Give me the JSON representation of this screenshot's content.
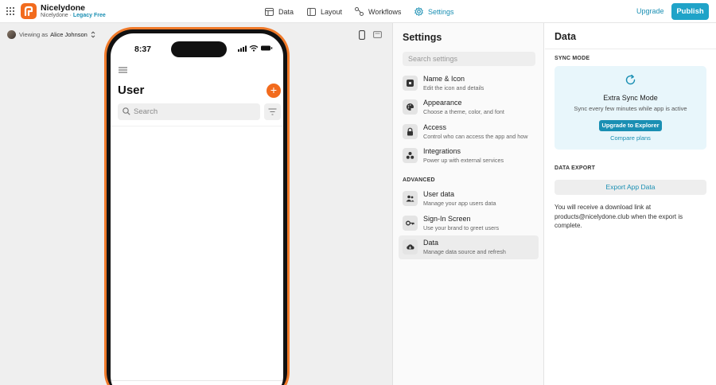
{
  "header": {
    "app_name": "Nicelydone",
    "workspace": "Nicelydone",
    "separator": "·",
    "plan": "Legacy Free",
    "nav": [
      {
        "label": "Data",
        "icon": "table-icon"
      },
      {
        "label": "Layout",
        "icon": "layout-icon"
      },
      {
        "label": "Workflows",
        "icon": "workflow-icon"
      },
      {
        "label": "Settings",
        "icon": "gear-icon",
        "active": true
      }
    ],
    "upgrade_label": "Upgrade",
    "publish_label": "Publish"
  },
  "canvas": {
    "viewing_prefix": "Viewing as",
    "viewing_user": "Alice Johnson",
    "phone": {
      "time": "8:37",
      "title": "User",
      "search_placeholder": "Search",
      "accent": "#f26b1d"
    }
  },
  "settings": {
    "title": "Settings",
    "search_placeholder": "Search settings",
    "items": [
      {
        "label": "Name & Icon",
        "desc": "Edit the icon and details",
        "icon": "app-icon"
      },
      {
        "label": "Appearance",
        "desc": "Choose a theme, color, and font",
        "icon": "palette-icon"
      },
      {
        "label": "Access",
        "desc": "Control who can access the app and how",
        "icon": "lock-icon"
      },
      {
        "label": "Integrations",
        "desc": "Power up with external services",
        "icon": "integrations-icon"
      }
    ],
    "advanced_heading": "ADVANCED",
    "advanced_items": [
      {
        "label": "User data",
        "desc": "Manage your app users data",
        "icon": "users-icon"
      },
      {
        "label": "Sign-In Screen",
        "desc": "Use your brand to greet users",
        "icon": "key-icon"
      },
      {
        "label": "Data",
        "desc": "Manage data source and refresh",
        "icon": "cloud-icon",
        "active": true
      }
    ]
  },
  "data_panel": {
    "title": "Data",
    "sync_heading": "SYNC MODE",
    "sync_title": "Extra Sync Mode",
    "sync_desc": "Sync every few minutes while app is active",
    "upgrade_label": "Upgrade to Explorer",
    "compare_label": "Compare plans",
    "export_heading": "DATA EXPORT",
    "export_label": "Export App Data",
    "export_note": "You will receive a download link at products@nicelydone.club when the export is complete."
  },
  "colors": {
    "accent": "#1a8fb3",
    "primary_button": "#1fa3c8",
    "brand_orange": "#f26b1d",
    "sync_card_bg": "#e8f6fb"
  }
}
